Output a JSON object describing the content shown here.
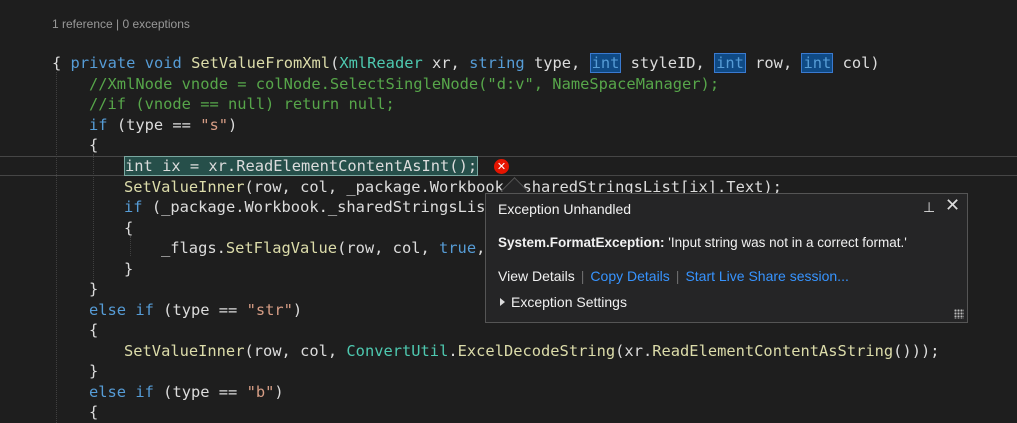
{
  "codelens": "1 reference | 0 exceptions",
  "code": {
    "sig_private": "private",
    "sig_void": "void",
    "sig_method": "SetValueFromXml",
    "sig_open": "(",
    "sig_type1": "XmlReader",
    "sig_p1": " xr, ",
    "sig_string": "string",
    "sig_p2": " type, ",
    "sig_int1": "int",
    "sig_p3": " styleID, ",
    "sig_int2": "int",
    "sig_p4": " row, ",
    "sig_int3": "int",
    "sig_p5": " col)",
    "brace_open": "{",
    "comment1": "//XmlNode vnode = colNode.SelectSingleNode(\"d:v\", NameSpaceManager);",
    "comment2": "//if (vnode == null) return null;",
    "if_kw": "if",
    "if_rest1": " (type == ",
    "if_str_s": "\"s\"",
    "if_close": ")",
    "brace_if_open": "{",
    "current_line": "int ix = xr.ReadElementContentAsInt();",
    "l1_method": "SetValueInner",
    "l1_a": "(row, col, _package.Workbook",
    "l1_b": "._sharedStringsList[ix].Text);",
    "l2_if": "if",
    "l2_rest": " (_package.Workbook._sharedStringsLis",
    "brace_inner_open": "{",
    "l3_flags": "_flags.",
    "l3_method": "SetFlagValue",
    "l3_rest": "(row, col, ",
    "l3_true": "true",
    "l3_comma": ",",
    "brace_inner_close": "}",
    "brace_if_close": "}",
    "else1_else": "else",
    "else1_if": "if",
    "else1_rest": " (type == ",
    "else1_str": "\"str\"",
    "else1_close": ")",
    "brace_e1_open": "{",
    "l4_method": "SetValueInner",
    "l4_a": "(row, col, ",
    "l4_type": "ConvertUtil",
    "l4_dot": ".",
    "l4_method2": "ExcelDecodeString",
    "l4_b": "(xr.",
    "l4_method3": "ReadElementContentAsString",
    "l4_c": "()));",
    "brace_e1_close": "}",
    "else2_else": "else",
    "else2_if": "if",
    "else2_rest": " (type == ",
    "else2_str": "\"b\"",
    "else2_close": ")",
    "brace_e2_open": "{"
  },
  "error_glyph": "✕",
  "popup": {
    "title": "Exception Unhandled",
    "pin_glyph": "⊥",
    "close_glyph": "✕",
    "exception_type": "System.FormatException:",
    "exception_message": " 'Input string was not in a correct format.'",
    "view_details": "View Details",
    "copy_details": "Copy Details",
    "live_share": "Start Live Share session...",
    "separator": "|",
    "settings": "Exception Settings"
  },
  "colors": {
    "keyword": "#569cd6",
    "type": "#4ec9b0",
    "method": "#dcdcaa",
    "comment": "#57a64a",
    "string": "#d69d85",
    "link": "#3794ff",
    "error": "#e51400"
  }
}
